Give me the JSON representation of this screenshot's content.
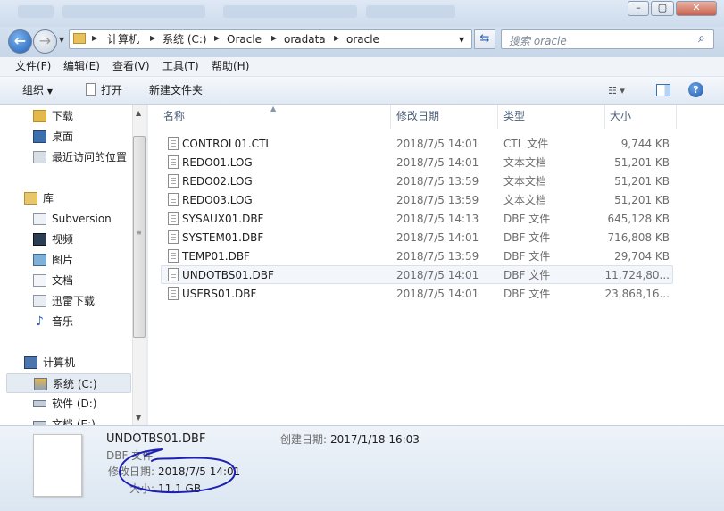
{
  "nav_path": [
    "计算机",
    "系统 (C:)",
    "Oracle",
    "oradata",
    "oracle"
  ],
  "search_placeholder": "搜索 oracle",
  "menu": [
    "文件(F)",
    "编辑(E)",
    "查看(V)",
    "工具(T)",
    "帮助(H)"
  ],
  "toolbar": {
    "organize": "组织",
    "open": "打开",
    "new_folder": "新建文件夹"
  },
  "sidebar": [
    {
      "label": "下载",
      "icon": "download-folder-icon"
    },
    {
      "label": "桌面",
      "icon": "desktop-icon"
    },
    {
      "label": "最近访问的位置",
      "icon": "recent-places-icon"
    },
    {
      "label": "库",
      "icon": "library-icon",
      "group": true
    },
    {
      "label": "Subversion",
      "icon": "subversion-icon"
    },
    {
      "label": "视频",
      "icon": "video-library-icon"
    },
    {
      "label": "图片",
      "icon": "picture-library-icon"
    },
    {
      "label": "文档",
      "icon": "document-library-icon"
    },
    {
      "label": "迅雷下载",
      "icon": "thunder-download-icon"
    },
    {
      "label": "音乐",
      "icon": "music-library-icon"
    },
    {
      "label": "计算机",
      "icon": "computer-icon",
      "group": true
    },
    {
      "label": "系统 (C:)",
      "icon": "system-drive-icon",
      "selected": true
    },
    {
      "label": "软件 (D:)",
      "icon": "drive-icon"
    },
    {
      "label": "文档 (E:)",
      "icon": "drive-icon"
    }
  ],
  "columns": [
    "名称",
    "修改日期",
    "类型",
    "大小"
  ],
  "files": [
    {
      "name": "CONTROL01.CTL",
      "date": "2018/7/5 14:01",
      "type": "CTL 文件",
      "size": "9,744 KB"
    },
    {
      "name": "REDO01.LOG",
      "date": "2018/7/5 14:01",
      "type": "文本文档",
      "size": "51,201 KB"
    },
    {
      "name": "REDO02.LOG",
      "date": "2018/7/5 13:59",
      "type": "文本文档",
      "size": "51,201 KB"
    },
    {
      "name": "REDO03.LOG",
      "date": "2018/7/5 13:59",
      "type": "文本文档",
      "size": "51,201 KB"
    },
    {
      "name": "SYSAUX01.DBF",
      "date": "2018/7/5 14:13",
      "type": "DBF 文件",
      "size": "645,128 KB"
    },
    {
      "name": "SYSTEM01.DBF",
      "date": "2018/7/5 14:01",
      "type": "DBF 文件",
      "size": "716,808 KB"
    },
    {
      "name": "TEMP01.DBF",
      "date": "2018/7/5 13:59",
      "type": "DBF 文件",
      "size": "29,704 KB"
    },
    {
      "name": "UNDOTBS01.DBF",
      "date": "2018/7/5 14:01",
      "type": "DBF 文件",
      "size": "11,724,80...",
      "selected": true
    },
    {
      "name": "USERS01.DBF",
      "date": "2018/7/5 14:01",
      "type": "DBF 文件",
      "size": "23,868,16..."
    }
  ],
  "details": {
    "name": "UNDOTBS01.DBF",
    "type": "DBF 文件",
    "modified_label": "修改日期:",
    "modified_value": "2018/7/5 14:01",
    "size_label": "大小:",
    "size_value": "11.1 GB",
    "created_label": "创建日期:",
    "created_value": "2017/1/18 16:03"
  },
  "colors": {
    "accent": "#3a78c8",
    "annotation": "#1d1fb5"
  }
}
